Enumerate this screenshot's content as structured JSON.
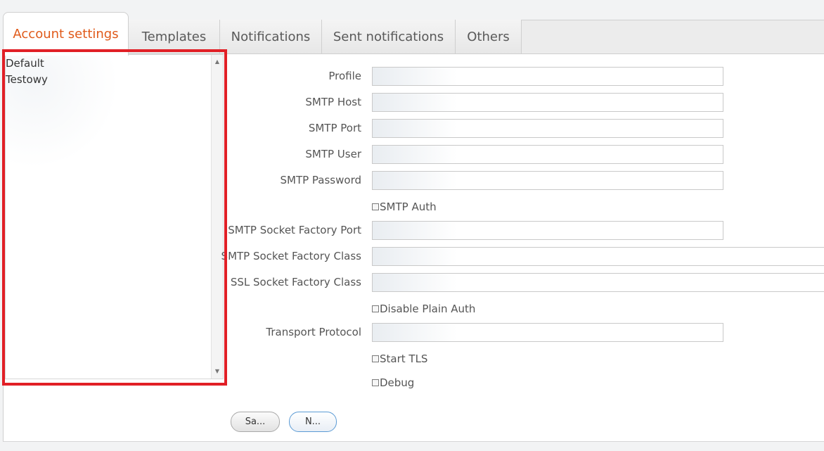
{
  "tabs": [
    {
      "label": "Account settings",
      "active": true
    },
    {
      "label": "Templates"
    },
    {
      "label": "Notifications"
    },
    {
      "label": "Sent notifications"
    },
    {
      "label": "Others"
    }
  ],
  "profiles": [
    "Default",
    "Testowy"
  ],
  "form": {
    "profile_label": "Profile",
    "smtp_host_label": "SMTP Host",
    "smtp_port_label": "SMTP Port",
    "smtp_user_label": "SMTP User",
    "smtp_password_label": "SMTP Password",
    "smtp_auth_label": "SMTP Auth",
    "socket_factory_port_label": "SMTP Socket Factory Port",
    "socket_factory_class_label": "SMTP Socket Factory Class",
    "ssl_socket_factory_class_label": "SSL Socket Factory Class",
    "disable_plain_auth_label": "Disable Plain Auth",
    "transport_protocol_label": "Transport Protocol",
    "start_tls_label": "Start TLS",
    "debug_label": "Debug",
    "values": {
      "profile": "",
      "smtp_host": "",
      "smtp_port": "",
      "smtp_user": "",
      "smtp_password": "",
      "socket_factory_port": "",
      "socket_factory_class": "",
      "ssl_socket_factory_class": "",
      "transport_protocol": ""
    },
    "checks": {
      "smtp_auth": false,
      "disable_plain_auth": false,
      "start_tls": false,
      "debug": false
    }
  },
  "buttons": {
    "save_label": "Sa...",
    "new_label": "N..."
  },
  "colors": {
    "active_tab_text": "#e05a1a",
    "highlight_border": "#e11f26",
    "new_button_border": "#5b9bd5"
  }
}
